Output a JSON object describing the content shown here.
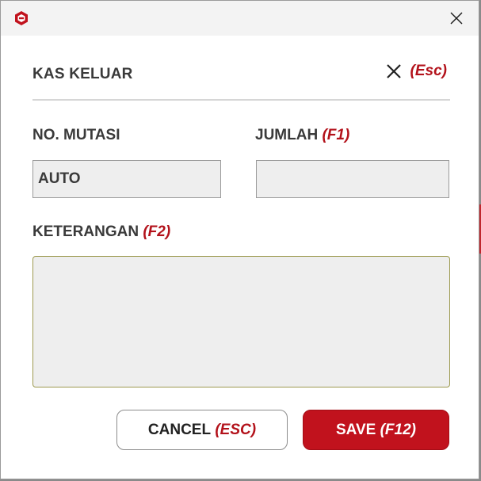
{
  "window": {
    "close_glyph": "✕"
  },
  "dialog": {
    "title": "KAS KELUAR",
    "close_hint": "(Esc)"
  },
  "form": {
    "no_mutasi": {
      "label": "NO. MUTASI",
      "value": "AUTO"
    },
    "jumlah": {
      "label": "JUMLAH",
      "hint": "(F1)",
      "value": ""
    },
    "keterangan": {
      "label": "KETERANGAN",
      "hint": "(F2)",
      "value": ""
    }
  },
  "buttons": {
    "cancel_label": "CANCEL",
    "cancel_hint": "(ESC)",
    "save_label": "SAVE",
    "save_hint": "(F12)"
  },
  "colors": {
    "accent": "#c1121d",
    "hint_text": "#b3121b",
    "field_bg": "#eeeeee",
    "titlebar_bg": "#f3f3f3"
  },
  "icons": {
    "app": "app-logo-icon",
    "window_close": "close-icon",
    "dialog_close": "close-icon"
  }
}
